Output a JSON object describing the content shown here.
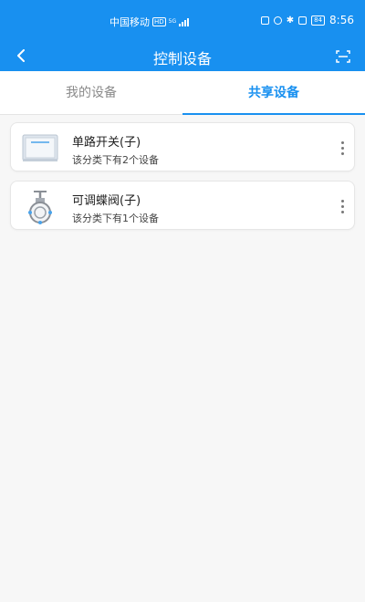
{
  "status_bar": {
    "carrier": "中国移动",
    "hd": "HD",
    "network": "5G",
    "battery": "84",
    "time": "8:56"
  },
  "header": {
    "title": "控制设备",
    "back_icon": "chevron-left-icon",
    "scan_icon": "scan-icon"
  },
  "tabs": [
    {
      "label": "我的设备",
      "active": false
    },
    {
      "label": "共享设备",
      "active": true
    }
  ],
  "colors": {
    "primary": "#1890f0",
    "background": "#f7f7f7",
    "card": "#ffffff"
  },
  "devices": [
    {
      "name": "单路开关(子)",
      "subtitle": "该分类下有2个设备",
      "icon": "switch-panel-icon"
    },
    {
      "name": "可调蝶阀(子)",
      "subtitle": "该分类下有1个设备",
      "icon": "butterfly-valve-icon"
    }
  ]
}
